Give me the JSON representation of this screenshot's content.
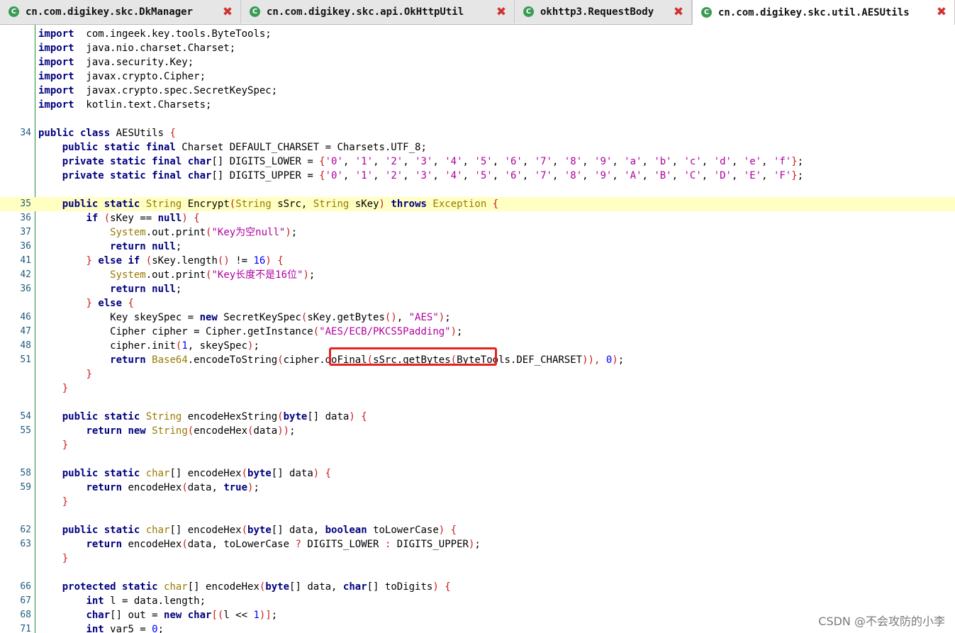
{
  "tabs": [
    {
      "title": "cn.com.digikey.skc.DkManager",
      "icon": "class-icon",
      "active": false
    },
    {
      "title": "cn.com.digikey.skc.api.OkHttpUtil",
      "icon": "class-icon",
      "active": false
    },
    {
      "title": "okhttp3.RequestBody",
      "icon": "class-icon",
      "active": false
    },
    {
      "title": "cn.com.digikey.skc.util.AESUtils",
      "icon": "class-icon",
      "active": true
    }
  ],
  "tab_icon_glyph": "C",
  "close_glyph": "✖",
  "colors": {
    "keyword": "#00007f",
    "type": "#997a00",
    "string": "#b000a0",
    "punctuation": "#cc1a1a",
    "number": "#0000ff",
    "line_number": "#1e5b7f",
    "highlight_line": "#ffffc2",
    "annotation_box": "#e3231f",
    "close_icon": "#d23030"
  },
  "code": [
    {
      "ln": "",
      "tokens": [
        [
          "kw",
          "import"
        ],
        [
          "",
          "  com.ingeek.key.tools.ByteTools;"
        ]
      ]
    },
    {
      "ln": "",
      "tokens": [
        [
          "kw",
          "import"
        ],
        [
          "",
          "  java.nio.charset.Charset;"
        ]
      ]
    },
    {
      "ln": "",
      "tokens": [
        [
          "kw",
          "import"
        ],
        [
          "",
          "  java.security.Key;"
        ]
      ]
    },
    {
      "ln": "",
      "tokens": [
        [
          "kw",
          "import"
        ],
        [
          "",
          "  javax.crypto.Cipher;"
        ]
      ]
    },
    {
      "ln": "",
      "tokens": [
        [
          "kw",
          "import"
        ],
        [
          "",
          "  javax.crypto.spec.SecretKeySpec;"
        ]
      ]
    },
    {
      "ln": "",
      "tokens": [
        [
          "kw",
          "import"
        ],
        [
          "",
          "  kotlin.text.Charsets;"
        ]
      ]
    },
    {
      "ln": "",
      "tokens": []
    },
    {
      "ln": "34",
      "tokens": [
        [
          "kw",
          "public class"
        ],
        [
          "",
          " AESUtils "
        ],
        [
          "pu",
          "{"
        ]
      ]
    },
    {
      "ln": "",
      "tokens": [
        [
          "",
          "    "
        ],
        [
          "kw",
          "public static final"
        ],
        [
          "",
          " Charset DEFAULT_CHARSET = Charsets.UTF_8;"
        ]
      ]
    },
    {
      "ln": "",
      "tokens": [
        [
          "",
          "    "
        ],
        [
          "kw",
          "private static final"
        ],
        [
          "",
          " "
        ],
        [
          "kw",
          "char"
        ],
        [
          "",
          "[] DIGITS_LOWER = "
        ],
        [
          "pu",
          "{"
        ],
        [
          "st",
          "'0'"
        ],
        [
          "",
          ", "
        ],
        [
          "st",
          "'1'"
        ],
        [
          "",
          ", "
        ],
        [
          "st",
          "'2'"
        ],
        [
          "",
          ", "
        ],
        [
          "st",
          "'3'"
        ],
        [
          "",
          ", "
        ],
        [
          "st",
          "'4'"
        ],
        [
          "",
          ", "
        ],
        [
          "st",
          "'5'"
        ],
        [
          "",
          ", "
        ],
        [
          "st",
          "'6'"
        ],
        [
          "",
          ", "
        ],
        [
          "st",
          "'7'"
        ],
        [
          "",
          ", "
        ],
        [
          "st",
          "'8'"
        ],
        [
          "",
          ", "
        ],
        [
          "st",
          "'9'"
        ],
        [
          "",
          ", "
        ],
        [
          "st",
          "'a'"
        ],
        [
          "",
          ", "
        ],
        [
          "st",
          "'b'"
        ],
        [
          "",
          ", "
        ],
        [
          "st",
          "'c'"
        ],
        [
          "",
          ", "
        ],
        [
          "st",
          "'d'"
        ],
        [
          "",
          ", "
        ],
        [
          "st",
          "'e'"
        ],
        [
          "",
          ", "
        ],
        [
          "st",
          "'f'"
        ],
        [
          "pu",
          "}"
        ],
        [
          "",
          ";"
        ]
      ]
    },
    {
      "ln": "",
      "tokens": [
        [
          "",
          "    "
        ],
        [
          "kw",
          "private static final"
        ],
        [
          "",
          " "
        ],
        [
          "kw",
          "char"
        ],
        [
          "",
          "[] DIGITS_UPPER = "
        ],
        [
          "pu",
          "{"
        ],
        [
          "st",
          "'0'"
        ],
        [
          "",
          ", "
        ],
        [
          "st",
          "'1'"
        ],
        [
          "",
          ", "
        ],
        [
          "st",
          "'2'"
        ],
        [
          "",
          ", "
        ],
        [
          "st",
          "'3'"
        ],
        [
          "",
          ", "
        ],
        [
          "st",
          "'4'"
        ],
        [
          "",
          ", "
        ],
        [
          "st",
          "'5'"
        ],
        [
          "",
          ", "
        ],
        [
          "st",
          "'6'"
        ],
        [
          "",
          ", "
        ],
        [
          "st",
          "'7'"
        ],
        [
          "",
          ", "
        ],
        [
          "st",
          "'8'"
        ],
        [
          "",
          ", "
        ],
        [
          "st",
          "'9'"
        ],
        [
          "",
          ", "
        ],
        [
          "st",
          "'A'"
        ],
        [
          "",
          ", "
        ],
        [
          "st",
          "'B'"
        ],
        [
          "",
          ", "
        ],
        [
          "st",
          "'C'"
        ],
        [
          "",
          ", "
        ],
        [
          "st",
          "'D'"
        ],
        [
          "",
          ", "
        ],
        [
          "st",
          "'E'"
        ],
        [
          "",
          ", "
        ],
        [
          "st",
          "'F'"
        ],
        [
          "pu",
          "}"
        ],
        [
          "",
          ";"
        ]
      ]
    },
    {
      "ln": "",
      "tokens": []
    },
    {
      "ln": "35",
      "hl": true,
      "tokens": [
        [
          "",
          "    "
        ],
        [
          "kw",
          "public static"
        ],
        [
          "",
          " "
        ],
        [
          "ty",
          "String"
        ],
        [
          "",
          " Encrypt"
        ],
        [
          "pu",
          "("
        ],
        [
          "ty",
          "String"
        ],
        [
          "",
          " sSrc, "
        ],
        [
          "ty",
          "String"
        ],
        [
          "",
          " sKey"
        ],
        [
          "pu",
          ")"
        ],
        [
          "",
          " "
        ],
        [
          "kw",
          "throws"
        ],
        [
          "",
          " "
        ],
        [
          "ty",
          "Exception"
        ],
        [
          "",
          " "
        ],
        [
          "pu",
          "{"
        ]
      ]
    },
    {
      "ln": "36",
      "tokens": [
        [
          "",
          "        "
        ],
        [
          "kw",
          "if"
        ],
        [
          "",
          " "
        ],
        [
          "pu",
          "("
        ],
        [
          "",
          "sKey == "
        ],
        [
          "kw",
          "null"
        ],
        [
          "pu",
          ")"
        ],
        [
          "",
          " "
        ],
        [
          "pu",
          "{"
        ]
      ]
    },
    {
      "ln": "37",
      "tokens": [
        [
          "",
          "            "
        ],
        [
          "ty",
          "System"
        ],
        [
          "",
          ".out.print"
        ],
        [
          "pu",
          "("
        ],
        [
          "st",
          "\"Key为空null\""
        ],
        [
          "pu",
          ")"
        ],
        [
          "",
          ";"
        ]
      ]
    },
    {
      "ln": "36",
      "tokens": [
        [
          "",
          "            "
        ],
        [
          "kw",
          "return null"
        ],
        [
          "",
          ";"
        ]
      ]
    },
    {
      "ln": "41",
      "tokens": [
        [
          "",
          "        "
        ],
        [
          "pu",
          "}"
        ],
        [
          "",
          " "
        ],
        [
          "kw",
          "else if"
        ],
        [
          "",
          " "
        ],
        [
          "pu",
          "("
        ],
        [
          "",
          "sKey.length"
        ],
        [
          "pu",
          "()"
        ],
        [
          "",
          " != "
        ],
        [
          "nu",
          "16"
        ],
        [
          "pu",
          ")"
        ],
        [
          "",
          " "
        ],
        [
          "pu",
          "{"
        ]
      ]
    },
    {
      "ln": "42",
      "tokens": [
        [
          "",
          "            "
        ],
        [
          "ty",
          "System"
        ],
        [
          "",
          ".out.print"
        ],
        [
          "pu",
          "("
        ],
        [
          "st",
          "\"Key长度不是16位\""
        ],
        [
          "pu",
          ")"
        ],
        [
          "",
          ";"
        ]
      ]
    },
    {
      "ln": "36",
      "tokens": [
        [
          "",
          "            "
        ],
        [
          "kw",
          "return null"
        ],
        [
          "",
          ";"
        ]
      ]
    },
    {
      "ln": "",
      "tokens": [
        [
          "",
          "        "
        ],
        [
          "pu",
          "}"
        ],
        [
          "",
          " "
        ],
        [
          "kw",
          "else"
        ],
        [
          "",
          " "
        ],
        [
          "pu",
          "{"
        ]
      ]
    },
    {
      "ln": "46",
      "tokens": [
        [
          "",
          "            Key skeySpec = "
        ],
        [
          "kw",
          "new"
        ],
        [
          "",
          " SecretKeySpec"
        ],
        [
          "pu",
          "("
        ],
        [
          "",
          "sKey.getBytes"
        ],
        [
          "pu",
          "()"
        ],
        [
          "",
          ", "
        ],
        [
          "st",
          "\"AES\""
        ],
        [
          "pu",
          ")"
        ],
        [
          "",
          ";"
        ]
      ]
    },
    {
      "ln": "47",
      "tokens": [
        [
          "",
          "            Cipher cipher = Cipher.getInstance"
        ],
        [
          "pu",
          "("
        ],
        [
          "st",
          "\"AES/ECB/PKCS5Padding\""
        ],
        [
          "pu",
          ")"
        ],
        [
          "",
          ";"
        ]
      ]
    },
    {
      "ln": "48",
      "tokens": [
        [
          "",
          "            cipher.init"
        ],
        [
          "pu",
          "("
        ],
        [
          "nu",
          "1"
        ],
        [
          "",
          ", skeySpec"
        ],
        [
          "pu",
          ")"
        ],
        [
          "",
          ";"
        ]
      ]
    },
    {
      "ln": "51",
      "tokens": [
        [
          "",
          "            "
        ],
        [
          "kw",
          "return"
        ],
        [
          "",
          " "
        ],
        [
          "ty",
          "Base64"
        ],
        [
          "",
          ".encodeToString"
        ],
        [
          "pu",
          "("
        ],
        [
          "",
          "cipher.doFinal"
        ],
        [
          "pu",
          "("
        ],
        [
          "",
          "sSrc.getBytes"
        ],
        [
          "pu",
          "("
        ],
        [
          "",
          "ByteTools.DEF_CHARSET"
        ],
        [
          "pu",
          ")),"
        ],
        [
          "",
          " "
        ],
        [
          "nu",
          "0"
        ],
        [
          "pu",
          ")"
        ],
        [
          "",
          ";"
        ]
      ]
    },
    {
      "ln": "",
      "tokens": [
        [
          "",
          "        "
        ],
        [
          "pu",
          "}"
        ]
      ]
    },
    {
      "ln": "",
      "tokens": [
        [
          "",
          "    "
        ],
        [
          "pu",
          "}"
        ]
      ]
    },
    {
      "ln": "",
      "tokens": []
    },
    {
      "ln": "54",
      "tokens": [
        [
          "",
          "    "
        ],
        [
          "kw",
          "public static"
        ],
        [
          "",
          " "
        ],
        [
          "ty",
          "String"
        ],
        [
          "",
          " encodeHexString"
        ],
        [
          "pu",
          "("
        ],
        [
          "kw",
          "byte"
        ],
        [
          "",
          "[] data"
        ],
        [
          "pu",
          ")"
        ],
        [
          "",
          " "
        ],
        [
          "pu",
          "{"
        ]
      ]
    },
    {
      "ln": "55",
      "tokens": [
        [
          "",
          "        "
        ],
        [
          "kw",
          "return new"
        ],
        [
          "",
          " "
        ],
        [
          "ty",
          "String"
        ],
        [
          "pu",
          "("
        ],
        [
          "",
          "encodeHex"
        ],
        [
          "pu",
          "("
        ],
        [
          "",
          "data"
        ],
        [
          "pu",
          "))"
        ],
        [
          "",
          ";"
        ]
      ]
    },
    {
      "ln": "",
      "tokens": [
        [
          "",
          "    "
        ],
        [
          "pu",
          "}"
        ]
      ]
    },
    {
      "ln": "",
      "tokens": []
    },
    {
      "ln": "58",
      "tokens": [
        [
          "",
          "    "
        ],
        [
          "kw",
          "public static"
        ],
        [
          "",
          " "
        ],
        [
          "ty",
          "char"
        ],
        [
          "",
          "[] encodeHex"
        ],
        [
          "pu",
          "("
        ],
        [
          "kw",
          "byte"
        ],
        [
          "",
          "[] data"
        ],
        [
          "pu",
          ")"
        ],
        [
          "",
          " "
        ],
        [
          "pu",
          "{"
        ]
      ]
    },
    {
      "ln": "59",
      "tokens": [
        [
          "",
          "        "
        ],
        [
          "kw",
          "return"
        ],
        [
          "",
          " encodeHex"
        ],
        [
          "pu",
          "("
        ],
        [
          "",
          "data, "
        ],
        [
          "kw",
          "true"
        ],
        [
          "pu",
          ")"
        ],
        [
          "",
          ";"
        ]
      ]
    },
    {
      "ln": "",
      "tokens": [
        [
          "",
          "    "
        ],
        [
          "pu",
          "}"
        ]
      ]
    },
    {
      "ln": "",
      "tokens": []
    },
    {
      "ln": "62",
      "tokens": [
        [
          "",
          "    "
        ],
        [
          "kw",
          "public static"
        ],
        [
          "",
          " "
        ],
        [
          "ty",
          "char"
        ],
        [
          "",
          "[] encodeHex"
        ],
        [
          "pu",
          "("
        ],
        [
          "kw",
          "byte"
        ],
        [
          "",
          "[] data, "
        ],
        [
          "kw",
          "boolean"
        ],
        [
          "",
          " toLowerCase"
        ],
        [
          "pu",
          ")"
        ],
        [
          "",
          " "
        ],
        [
          "pu",
          "{"
        ]
      ]
    },
    {
      "ln": "63",
      "tokens": [
        [
          "",
          "        "
        ],
        [
          "kw",
          "return"
        ],
        [
          "",
          " encodeHex"
        ],
        [
          "pu",
          "("
        ],
        [
          "",
          "data, toLowerCase "
        ],
        [
          "pu",
          "?"
        ],
        [
          "",
          " DIGITS_LOWER "
        ],
        [
          "pu",
          ":"
        ],
        [
          "",
          " DIGITS_UPPER"
        ],
        [
          "pu",
          ")"
        ],
        [
          "",
          ";"
        ]
      ]
    },
    {
      "ln": "",
      "tokens": [
        [
          "",
          "    "
        ],
        [
          "pu",
          "}"
        ]
      ]
    },
    {
      "ln": "",
      "tokens": []
    },
    {
      "ln": "66",
      "tokens": [
        [
          "",
          "    "
        ],
        [
          "kw",
          "protected static"
        ],
        [
          "",
          " "
        ],
        [
          "ty",
          "char"
        ],
        [
          "",
          "[] encodeHex"
        ],
        [
          "pu",
          "("
        ],
        [
          "kw",
          "byte"
        ],
        [
          "",
          "[] data, "
        ],
        [
          "kw",
          "char"
        ],
        [
          "",
          "[] toDigits"
        ],
        [
          "pu",
          ")"
        ],
        [
          "",
          " "
        ],
        [
          "pu",
          "{"
        ]
      ]
    },
    {
      "ln": "67",
      "tokens": [
        [
          "",
          "        "
        ],
        [
          "kw",
          "int"
        ],
        [
          "",
          " l = data.length;"
        ]
      ]
    },
    {
      "ln": "68",
      "tokens": [
        [
          "",
          "        "
        ],
        [
          "kw",
          "char"
        ],
        [
          "",
          "[] out = "
        ],
        [
          "kw",
          "new char"
        ],
        [
          "pu",
          "[("
        ],
        [
          "",
          "l << "
        ],
        [
          "nu",
          "1"
        ],
        [
          "pu",
          ")]"
        ],
        [
          "",
          ";"
        ]
      ]
    },
    {
      "ln": "71",
      "tokens": [
        [
          "",
          "        "
        ],
        [
          "kw",
          "int"
        ],
        [
          "",
          " var5 = "
        ],
        [
          "nu",
          "0"
        ],
        [
          "",
          ";"
        ]
      ]
    }
  ],
  "watermark": "CSDN @不会攻防的小李"
}
